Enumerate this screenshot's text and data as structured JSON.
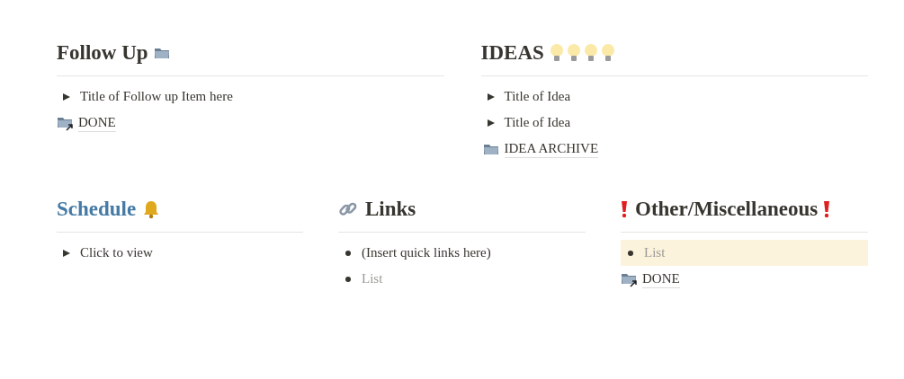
{
  "rows": [
    {
      "columns": [
        {
          "heading": {
            "title": "Follow Up",
            "color": "#37352f"
          },
          "items": [
            {
              "kind": "toggle",
              "text": "Title of Follow up Item here"
            },
            {
              "kind": "link_to_page",
              "text": "DONE"
            }
          ]
        },
        {
          "heading": {
            "title": "IDEAS",
            "color": "#37352f"
          },
          "items": [
            {
              "kind": "toggle",
              "text": "Title of Idea"
            },
            {
              "kind": "toggle",
              "text": "Title of Idea"
            },
            {
              "kind": "page",
              "text": "IDEA ARCHIVE"
            }
          ]
        }
      ]
    },
    {
      "columns": [
        {
          "heading": {
            "title": "Schedule",
            "color": "#447aa5"
          },
          "items": [
            {
              "kind": "toggle",
              "text": "Click to view"
            }
          ]
        },
        {
          "heading": {
            "title": "Links",
            "color": "#37352f"
          },
          "items": [
            {
              "kind": "bullet",
              "text": "(Insert quick links here)"
            },
            {
              "kind": "bullet",
              "placeholder": "List"
            }
          ]
        },
        {
          "heading": {
            "title": "Other/Miscellaneous",
            "color": "#37352f"
          },
          "items": [
            {
              "kind": "bullet",
              "placeholder": "List",
              "highlighted": true
            },
            {
              "kind": "link_to_page",
              "text": "DONE"
            }
          ]
        }
      ]
    }
  ]
}
